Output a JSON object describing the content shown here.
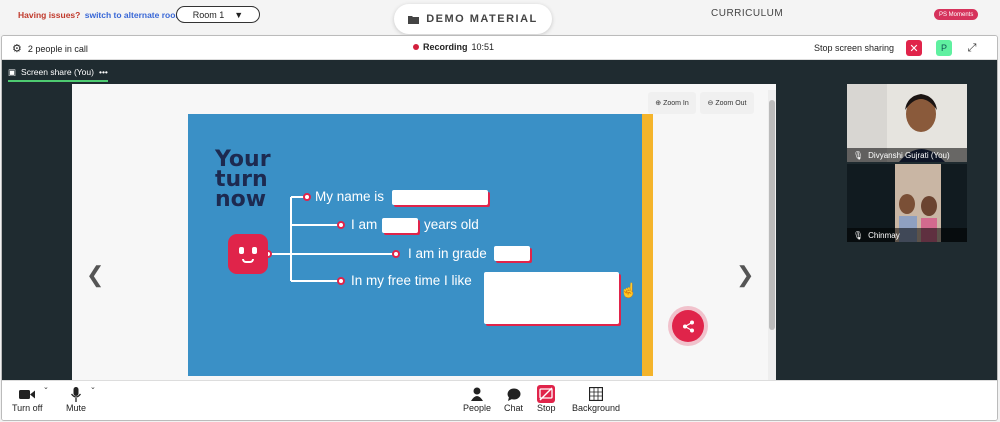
{
  "topbar": {
    "issues_text": "Having issues?",
    "alternate_link": "switch to alternate room",
    "room_selected": "Room 1",
    "demo_material_label": "DEMO MATERIAL",
    "curriculum_label": "CURRICULUM",
    "moments_badge": "PS Moments"
  },
  "callbar": {
    "people_count": "2 people in call",
    "recording_label": "Recording",
    "recording_time": "10:51",
    "stop_share_label": "Stop screen sharing",
    "participant_initial": "P"
  },
  "share": {
    "tab_label": "Screen share (You)",
    "more": "•••",
    "zoom_in": "Zoom In",
    "zoom_out": "Zoom Out"
  },
  "slide": {
    "title_line1": "Your",
    "title_line2": "turn",
    "title_line3": "now",
    "line1": "My name is",
    "line2a": "I am",
    "line2b": "years old",
    "line3": "I am in grade",
    "line4": "In my free time I like"
  },
  "participants": [
    {
      "name": "Divyanshi Gujrati (You)"
    },
    {
      "name": "Chinmay"
    }
  ],
  "toolbar": {
    "turn_off": "Turn off",
    "mute": "Mute",
    "people": "People",
    "chat": "Chat",
    "stop": "Stop",
    "background": "Background"
  },
  "colors": {
    "slide_bg": "#3a90c6",
    "accent_red": "#e0244a",
    "accent_yellow": "#f4b42b",
    "title_navy": "#1d2a50",
    "stage_bg": "#1f2b30"
  }
}
